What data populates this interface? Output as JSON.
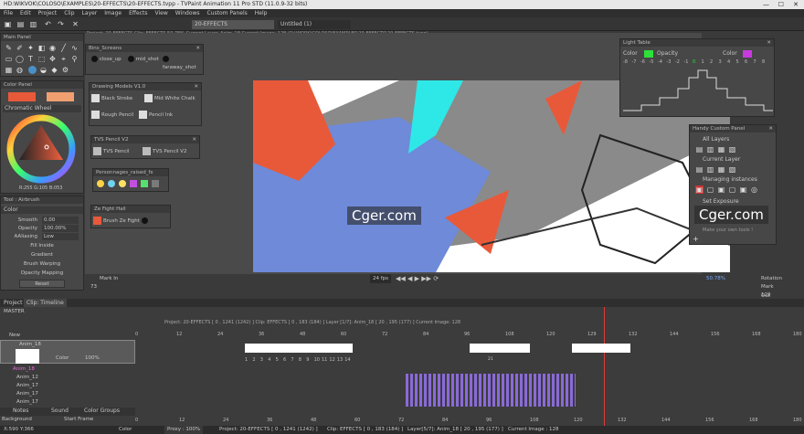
{
  "titlebar": {
    "title": "HD:WIKVOK\\COLOSO\\EXAMPLES\\20-EFFECTS\\20-EFFECTS.tvpp - TVPaint Animation 11 Pro STD (11.0.9-32 bits)"
  },
  "menu": [
    "File",
    "Edit",
    "Project",
    "Clip",
    "Layer",
    "Image",
    "Effects",
    "View",
    "Windows",
    "Custom Panels",
    "Help"
  ],
  "tabs": {
    "clip": "20-EFFECTS",
    "untitled": "Untitled (1)"
  },
  "project_info": "Project: 20-EFFECTS   Clip: EFFECTS   50.78%   Current Layer: Anim_18   Current Image: 128  (D:\\WORK\\COLOSO\\EXAMPLES\\20-EFFECTS\\20-EFFECTS.tvpp)",
  "main_panel": {
    "title": "Main Panel"
  },
  "color_panel": {
    "title": "Color Panel",
    "wheel_label": "Chromatic Wheel",
    "readout": "R:255 G:105 B:053",
    "color_a": "#e8593a",
    "color_b": "#f0a070"
  },
  "tool_panel": {
    "title": "Tool : Airbrush",
    "section": "Color",
    "smooth_label": "Smooth",
    "smooth_value": "0.00",
    "opacity_label": "Opacity",
    "opacity_value": "100.00%",
    "aa_label": "AAliasing",
    "aa_value": "Low",
    "fill_inside": "Fill Inside",
    "gradient": "Gradient",
    "brush_warping": "Brush Warping",
    "opacity_mapping": "Opacity Mapping",
    "reset": "Reset"
  },
  "bins": [
    {
      "title": "Bins_Screens",
      "items": [
        "close_up",
        "mid_shot",
        "faraway_shot"
      ]
    },
    {
      "title": "Drawing Models V1.0",
      "items": [
        "Black Stroke",
        "Mid White Chalk",
        "Rough Pencil",
        "Pencil Ink"
      ]
    },
    {
      "title": "TVS Pencil V2",
      "items": [
        "TVS Pencil",
        "TVS Pencil V2"
      ]
    },
    {
      "title": "Personnages_raised_fx",
      "items": []
    },
    {
      "title": "Ze Fight Hall",
      "items": [
        "Brush Ze Fight"
      ]
    }
  ],
  "light_table": {
    "title": "Light Table",
    "before_label": "Color",
    "opacity_label": "Opacity",
    "after_label": "Color",
    "before_color": "#2ee03a",
    "after_color": "#c83ae0",
    "numbers": [
      "-8",
      "-7",
      "-6",
      "-5",
      "-4",
      "-3",
      "-2",
      "-1",
      "0",
      "1",
      "2",
      "3",
      "4",
      "5",
      "6",
      "7",
      "8"
    ]
  },
  "handy_panel": {
    "title": "Handy Custom Panel",
    "items": [
      "All Layers",
      "Current Layer",
      "Managing instances",
      "Set Exposure",
      "Make your own tools !"
    ]
  },
  "canvas_bar": {
    "fps": "24 fps",
    "zoom": "50.78%",
    "rotation": "Rotation",
    "mark_in": "Mark In",
    "mark_out": "Mark Out",
    "in_frame": "73",
    "out_frame": "129"
  },
  "timeline": {
    "header_tab1": "Project",
    "header_tab2": "Clip: Timeline",
    "master": "MASTER",
    "summary": "Project: 20-EFFECTS [ 0 , 1241 (1242) ]     Clip: EFFECTS [ 0 , 183 (184) ]     Layer [1/7]: Anim_18 [ 20 , 195 (177) ]     Current Image: 128",
    "ruler": [
      "0",
      "12",
      "24",
      "36",
      "48",
      "60",
      "72",
      "84",
      "96",
      "108",
      "120",
      "129",
      "132",
      "144",
      "156",
      "168",
      "180"
    ],
    "bottom_ruler": [
      "0",
      "12",
      "24",
      "36",
      "48",
      "60",
      "72",
      "84",
      "96",
      "108",
      "120",
      "132",
      "144",
      "156",
      "168",
      "180"
    ],
    "new_label": "New",
    "layers": [
      {
        "name": "Anim_18",
        "mode": "Color",
        "opacity": "100%"
      },
      {
        "name": "Anim_18",
        "mode": "",
        "opacity": ""
      },
      {
        "name": "Anim_12",
        "mode": "",
        "opacity": ""
      },
      {
        "name": "Anim_17",
        "mode": "",
        "opacity": ""
      },
      {
        "name": "Anim_17",
        "mode": "",
        "opacity": ""
      },
      {
        "name": "Anim_17",
        "mode": "",
        "opacity": ""
      }
    ],
    "bottom_tabs": [
      "Notes",
      "Sound",
      "Color Groups"
    ],
    "background_label": "Background",
    "start_frame": "Start Frame",
    "frame_numbers": [
      "1",
      "2",
      "3",
      "4",
      "5",
      "6",
      "7",
      "8",
      "9",
      "10",
      "11",
      "12",
      "13",
      "14"
    ],
    "frame_21": "21"
  },
  "statusbar": {
    "coords": "X:590  Y:366",
    "mode": "Color",
    "proxy": "Proxy : 100%",
    "project": "Project: 20-EFFECTS [ 0 , 1241 (1242) ]",
    "clip": "Clip: EFFECTS [ 0 , 183 (184) ]",
    "layer": "Layer[5/7]: Anim_18 [ 20 , 195 (177) ]",
    "image": "Current Image : 128"
  },
  "watermark": "Cger.com",
  "bin_swatches": [
    "#ffd447",
    "#6fd3f0",
    "#ffe066",
    "#c24fe0",
    "#58e06f",
    "#7a7a7a"
  ]
}
